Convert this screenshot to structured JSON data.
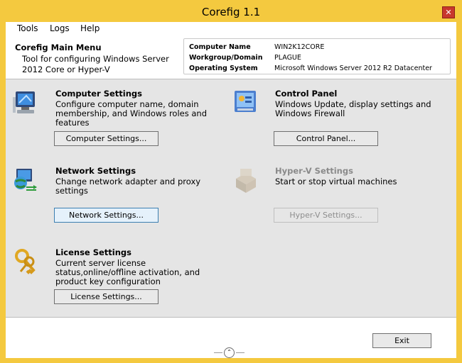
{
  "window": {
    "title": "Corefig 1.1",
    "close_glyph": "✕"
  },
  "menu": [
    "Tools",
    "Logs",
    "Help"
  ],
  "header": {
    "title": "Corefig Main Menu",
    "desc": "Tool for configuring Windows Server 2012 Core or Hyper-V",
    "info": [
      {
        "label": "Computer Name",
        "value": "WIN2K12CORE"
      },
      {
        "label": "Workgroup/Domain",
        "value": "PLAGUE"
      },
      {
        "label": "Operating System",
        "value": "Microsoft Windows Server 2012 R2 Datacenter"
      }
    ]
  },
  "sections": {
    "computer": {
      "title": "Computer Settings",
      "desc": "Configure computer name, domain membership, and Windows roles and features",
      "button": "Computer Settings...",
      "icon": "computer-icon"
    },
    "control": {
      "title": "Control Panel",
      "desc": "Windows Update, display settings and Windows Firewall",
      "button": "Control Panel...",
      "icon": "control-panel-icon"
    },
    "network": {
      "title": "Network Settings",
      "desc": "Change network adapter and proxy settings",
      "button": "Network Settings...",
      "icon": "network-globe-icon"
    },
    "hyperv": {
      "title": "Hyper-V Settings",
      "desc": "Start or stop virtual machines",
      "button": "Hyper-V Settings...",
      "icon": "hyperv-icon"
    },
    "license": {
      "title": "License Settings",
      "desc": "Current server license status,online/offline activation, and product key configuration",
      "button": "License Settings...",
      "icon": "keys-icon"
    }
  },
  "footer": {
    "exit": "Exit",
    "collapse_glyph": "⌃"
  },
  "colors": {
    "titlebar": "#f4c93f",
    "close": "#c8372d",
    "panel": "#e5e5e5"
  }
}
